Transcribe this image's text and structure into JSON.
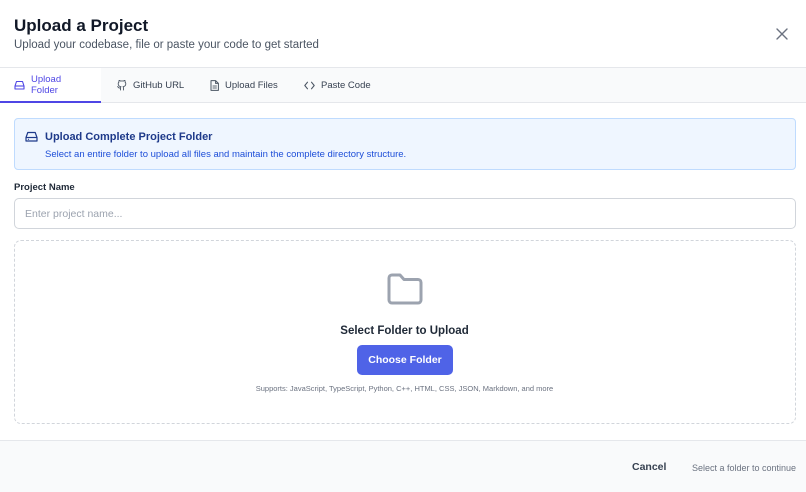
{
  "dialog": {
    "title": "Upload a Project",
    "subtitle": "Upload your codebase, file or paste your code to get started",
    "close_icon": "close-icon"
  },
  "tabs": [
    {
      "label": "Upload Folder",
      "icon": "drive-icon",
      "active": true
    },
    {
      "label": "GitHub URL",
      "icon": "github-icon",
      "active": false
    },
    {
      "label": "Upload Files",
      "icon": "file-icon",
      "active": false
    },
    {
      "label": "Paste Code",
      "icon": "code-icon",
      "active": false
    }
  ],
  "info": {
    "title": "Upload Complete Project Folder",
    "description": "Select an entire folder to upload all files and maintain the complete directory structure.",
    "icon": "drive-icon"
  },
  "project_name": {
    "label": "Project Name",
    "placeholder": "Enter project name...",
    "value": ""
  },
  "dropzone": {
    "icon": "folder-icon",
    "title": "Select Folder to Upload",
    "button_label": "Choose Folder",
    "supports": "Supports: JavaScript, TypeScript, Python, C++, HTML, CSS, JSON, Markdown, and more"
  },
  "footer": {
    "cancel_label": "Cancel",
    "hint": "Select a folder to continue"
  },
  "colors": {
    "accent": "#4f46e5",
    "button": "#4f63e7",
    "info_bg": "#eff6ff",
    "info_border": "#bfdbfe"
  }
}
